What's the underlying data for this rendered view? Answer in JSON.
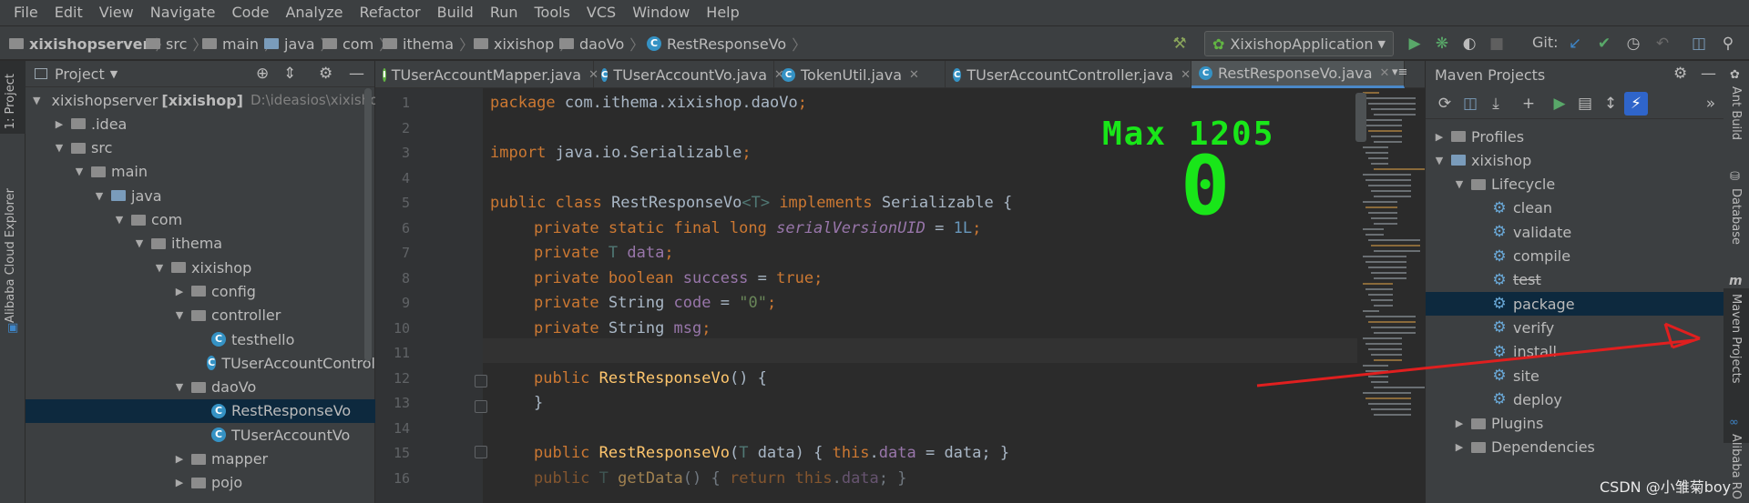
{
  "menu": [
    "File",
    "Edit",
    "View",
    "Navigate",
    "Code",
    "Analyze",
    "Refactor",
    "Build",
    "Run",
    "Tools",
    "VCS",
    "Window",
    "Help"
  ],
  "breadcrumbs": [
    "xixishopserver",
    "src",
    "main",
    "java",
    "com",
    "ithema",
    "xixishop",
    "daoVo",
    "RestResponseVo"
  ],
  "toolbar": {
    "run_config": "XixishopApplication",
    "git_label": "Git:",
    "icons": [
      "hammer-icon",
      "run-icon",
      "debug-icon",
      "coverage-icon",
      "stop-icon",
      "git-update-icon",
      "git-commit-icon",
      "history-icon",
      "revert-icon",
      "project-structure-icon",
      "search-everywhere-icon"
    ]
  },
  "left_stripe": {
    "project_tab": "1: Project",
    "alibaba_tab": "Alibaba Cloud Explorer"
  },
  "project_panel": {
    "title": "Project",
    "tree": [
      {
        "label": "xixishopserver",
        "bold_suffix": "[xixishop]",
        "hint": "D:\\ideasios\\xixishop",
        "level": 0,
        "expanded": true,
        "kind": "module"
      },
      {
        "label": ".idea",
        "level": 1,
        "expanded": false,
        "kind": "folder"
      },
      {
        "label": "src",
        "level": 1,
        "expanded": true,
        "kind": "folder"
      },
      {
        "label": "main",
        "level": 2,
        "expanded": true,
        "kind": "folder"
      },
      {
        "label": "java",
        "level": 3,
        "expanded": true,
        "kind": "source"
      },
      {
        "label": "com",
        "level": 4,
        "expanded": true,
        "kind": "package"
      },
      {
        "label": "ithema",
        "level": 5,
        "expanded": true,
        "kind": "package"
      },
      {
        "label": "xixishop",
        "level": 6,
        "expanded": true,
        "kind": "package"
      },
      {
        "label": "config",
        "level": 7,
        "expanded": false,
        "kind": "package"
      },
      {
        "label": "controller",
        "level": 7,
        "expanded": true,
        "kind": "package"
      },
      {
        "label": "testhello",
        "level": 8,
        "kind": "class"
      },
      {
        "label": "TUserAccountControl",
        "level": 8,
        "kind": "class"
      },
      {
        "label": "daoVo",
        "level": 7,
        "expanded": true,
        "kind": "package"
      },
      {
        "label": "RestResponseVo",
        "level": 8,
        "kind": "class",
        "selected": true
      },
      {
        "label": "TUserAccountVo",
        "level": 8,
        "kind": "class"
      },
      {
        "label": "mapper",
        "level": 7,
        "expanded": false,
        "kind": "package"
      },
      {
        "label": "pojo",
        "level": 7,
        "expanded": false,
        "kind": "package"
      }
    ]
  },
  "editor_tabs": [
    {
      "label": "TUserAccountMapper.java",
      "icon": "I",
      "color": "#62b543"
    },
    {
      "label": "TUserAccountVo.java",
      "icon": "C",
      "color": "#3592c4"
    },
    {
      "label": "TokenUtil.java",
      "icon": "C",
      "color": "#3592c4"
    },
    {
      "label": "TUserAccountController.java",
      "icon": "C",
      "color": "#3592c4"
    },
    {
      "label": "RestResponseVo.java",
      "icon": "C",
      "color": "#3592c4",
      "active": true
    }
  ],
  "code_lines": [
    "1",
    "2",
    "3",
    "4",
    "5",
    "6",
    "7",
    "8",
    "9",
    "10",
    "11",
    "12",
    "13",
    "14",
    "15",
    "16"
  ],
  "code": {
    "l1": [
      "package ",
      "com.ithema.xixishop.daoVo",
      ";"
    ],
    "l3": [
      "import ",
      "java.io.Serializable",
      ";"
    ],
    "l5": [
      "public class ",
      "RestResponseVo",
      "<T>",
      " implements ",
      "Serializable {"
    ],
    "l6": [
      "private static final long ",
      "serialVersionUID",
      " = ",
      "1L",
      ";"
    ],
    "l7": [
      "private ",
      "T",
      " ",
      "data",
      ";"
    ],
    "l8": [
      "private boolean ",
      "success",
      " = ",
      "true",
      ";"
    ],
    "l9": [
      "private ",
      "String ",
      "code",
      " = ",
      "\"0\"",
      ";"
    ],
    "l10": [
      "private ",
      "String ",
      "msg",
      ";"
    ],
    "l12": [
      "public ",
      "RestResponseVo",
      "() {"
    ],
    "l13": [
      "}"
    ],
    "l15": [
      "public ",
      "RestResponseVo",
      "(",
      "T",
      " data) { ",
      "this",
      ".",
      "data",
      " = data; }"
    ],
    "l16": [
      "public ",
      "T ",
      "getData",
      "() { ",
      "return this",
      ".",
      "data",
      "; }"
    ]
  },
  "overlay": {
    "counter_text": "Max 1205",
    "big_digit": "0"
  },
  "maven": {
    "title": "Maven Projects",
    "tree": [
      {
        "label": "Profiles",
        "level": 0,
        "expanded": false,
        "kind": "folder"
      },
      {
        "label": "xixishop",
        "level": 0,
        "expanded": true,
        "kind": "maven"
      },
      {
        "label": "Lifecycle",
        "level": 1,
        "expanded": true,
        "kind": "folder"
      },
      {
        "label": "clean",
        "level": 2,
        "kind": "goal"
      },
      {
        "label": "validate",
        "level": 2,
        "kind": "goal"
      },
      {
        "label": "compile",
        "level": 2,
        "kind": "goal"
      },
      {
        "label": "test",
        "level": 2,
        "kind": "goal",
        "struck": true
      },
      {
        "label": "package",
        "level": 2,
        "kind": "goal",
        "selected": true
      },
      {
        "label": "verify",
        "level": 2,
        "kind": "goal"
      },
      {
        "label": "install",
        "level": 2,
        "kind": "goal"
      },
      {
        "label": "site",
        "level": 2,
        "kind": "goal"
      },
      {
        "label": "deploy",
        "level": 2,
        "kind": "goal"
      },
      {
        "label": "Plugins",
        "level": 1,
        "expanded": false,
        "kind": "folder"
      },
      {
        "label": "Dependencies",
        "level": 1,
        "expanded": false,
        "kind": "folder"
      }
    ]
  },
  "right_stripe": {
    "ant": "Ant Build",
    "database": "Database",
    "maven": "Maven Projects",
    "alibaba": "Alibaba RO"
  },
  "watermark": "CSDN @小雏菊boy",
  "colors": {
    "accent": "#4a88c7",
    "annotation_arrow": "#e01f1f",
    "overlay_green": "#19e619",
    "selection": "#0d293e"
  }
}
